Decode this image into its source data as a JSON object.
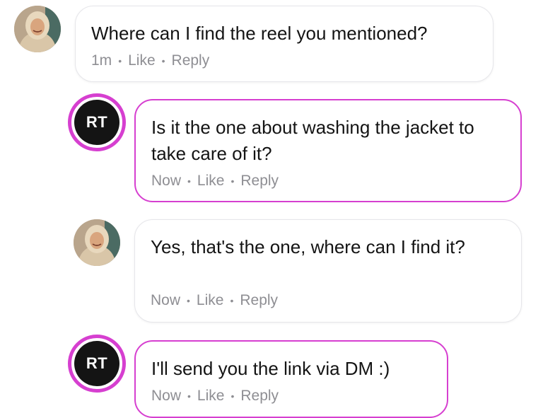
{
  "comments": [
    {
      "author_initials": "",
      "avatar": "user-photo",
      "text": "Where can I find the reel you mentioned?",
      "time": "1m",
      "like_label": "Like",
      "reply_label": "Reply"
    },
    {
      "author_initials": "RT",
      "avatar": "initials",
      "text": "Is it the one about washing the jacket to take care of it?",
      "time": "Now",
      "like_label": "Like",
      "reply_label": "Reply"
    },
    {
      "author_initials": "",
      "avatar": "user-photo",
      "text": "Yes, that's the one, where can I find it?",
      "time": "Now",
      "like_label": "Like",
      "reply_label": "Reply"
    },
    {
      "author_initials": "RT",
      "avatar": "initials",
      "text": "I'll send you the link via DM :)",
      "time": "Now",
      "like_label": "Like",
      "reply_label": "Reply"
    }
  ],
  "colors": {
    "highlight_border": "#d63fd0",
    "bubble_border": "#e6e6ea",
    "meta_text": "#8e8e93",
    "avatar_initials_bg": "#141414"
  }
}
